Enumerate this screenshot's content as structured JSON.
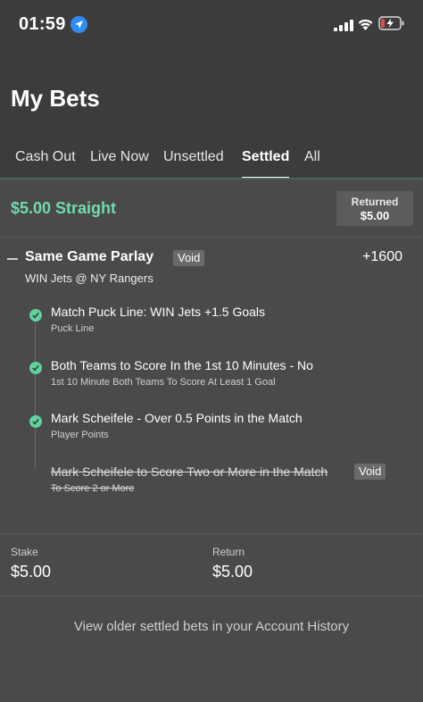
{
  "status_bar": {
    "time": "01:59",
    "icons": [
      "location-icon",
      "signal-icon",
      "wifi-icon",
      "battery-charging-icon"
    ],
    "battery_color": "#e24a4a"
  },
  "page_title": "My Bets",
  "tabs": [
    {
      "label": "Cash Out",
      "active": false
    },
    {
      "label": "Live Now",
      "active": false
    },
    {
      "label": "Unsettled",
      "active": false
    },
    {
      "label": "Settled",
      "active": true
    },
    {
      "label": "All",
      "active": false
    }
  ],
  "bet": {
    "title": "$5.00 Straight",
    "returned_label": "Returned",
    "returned_value": "$5.00",
    "parlay_title": "Same Game Parlay",
    "parlay_badge": "Void",
    "odds": "+1600",
    "matchup": "WIN Jets @ NY Rangers",
    "legs": [
      {
        "title": "Match Puck Line: WIN Jets +1.5 Goals",
        "subtitle": "Puck Line",
        "status": "won",
        "voided": false
      },
      {
        "title": "Both Teams to Score In the 1st 10 Minutes - No",
        "subtitle": "1st 10 Minute Both Teams To Score At Least 1 Goal",
        "status": "won",
        "voided": false
      },
      {
        "title": "Mark Scheifele - Over 0.5 Points in the Match",
        "subtitle": "Player Points",
        "status": "won",
        "voided": false
      },
      {
        "title": "Mark Scheifele to Score Two or More in the Match",
        "subtitle": "To Score 2 or More",
        "status": "void",
        "voided": true,
        "badge": "Void"
      }
    ],
    "stake_label": "Stake",
    "stake_value": "$5.00",
    "return_label": "Return",
    "return_value": "$5.00"
  },
  "history_link": "View older settled bets in your Account History",
  "colors": {
    "accent": "#6fdcae",
    "check": "#5fd39b",
    "header_bg": "#3c3c3c",
    "body_bg": "#4a4a4a"
  }
}
